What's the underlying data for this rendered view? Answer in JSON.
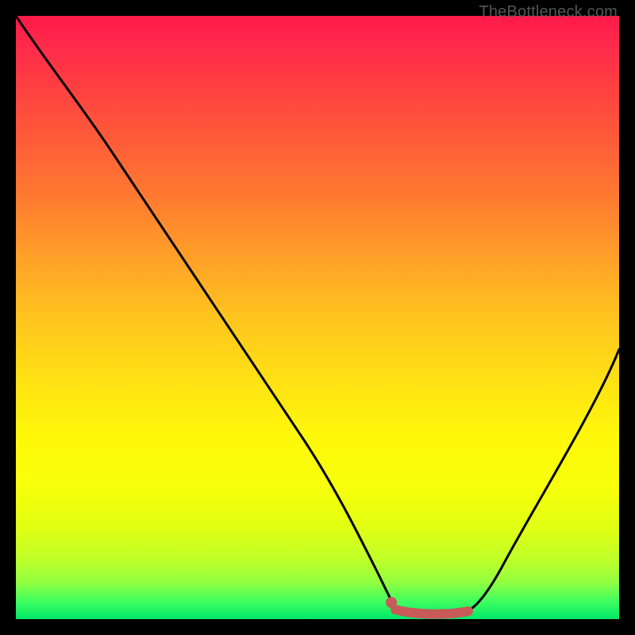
{
  "watermark": "TheBottleneck.com",
  "colors": {
    "black": "#000000",
    "curve": "#000000",
    "marker": "#c85a5a",
    "watermark_text": "#555555"
  },
  "chart_data": {
    "type": "line",
    "title": "",
    "xlabel": "",
    "ylabel": "",
    "xlim": [
      0,
      100
    ],
    "ylim": [
      0,
      100
    ],
    "series": [
      {
        "name": "bottleneck-curve",
        "x": [
          0,
          5,
          10,
          15,
          20,
          25,
          30,
          35,
          40,
          45,
          50,
          55,
          60,
          62,
          65,
          68,
          70,
          73,
          76,
          80,
          85,
          90,
          95,
          100
        ],
        "y": [
          100,
          97,
          91,
          84,
          76,
          68,
          60,
          52,
          44,
          36,
          28,
          20,
          11,
          6,
          2,
          0.5,
          0,
          0,
          0.5,
          3,
          10,
          20,
          32,
          46
        ]
      }
    ],
    "markers": [
      {
        "name": "highlight-start",
        "x": 62,
        "y": 3
      },
      {
        "name": "highlight-segment",
        "x_range": [
          62,
          76
        ],
        "y": 0.8
      }
    ],
    "gradient_background": {
      "type": "vertical",
      "stops": [
        {
          "pos": 0,
          "color": "#ff1a4a"
        },
        {
          "pos": 50,
          "color": "#ffc41e"
        },
        {
          "pos": 80,
          "color": "#f8ff0a"
        },
        {
          "pos": 100,
          "color": "#00e868"
        }
      ]
    }
  }
}
